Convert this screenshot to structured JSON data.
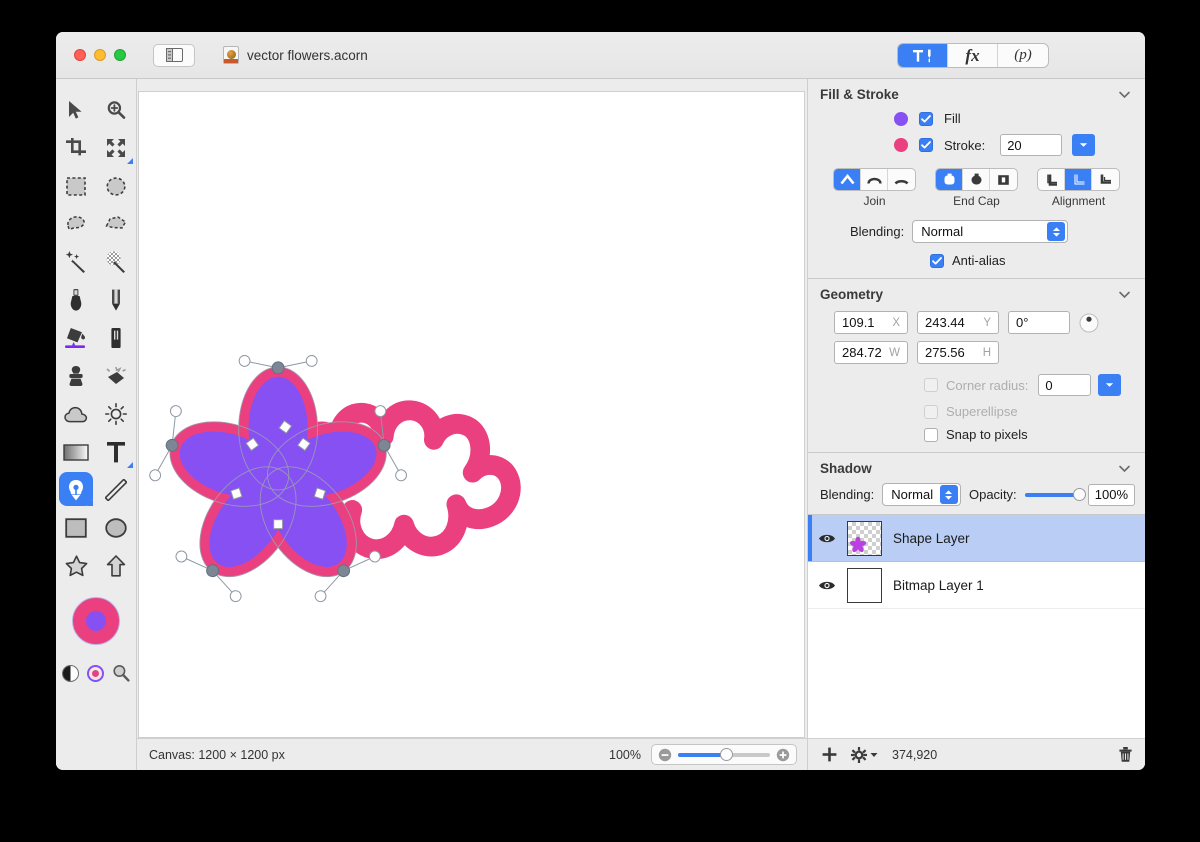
{
  "window": {
    "document_title": "vector flowers.acorn",
    "traffic_lights": [
      "close",
      "minimize",
      "zoom"
    ],
    "mode_buttons": [
      {
        "id": "tools",
        "label": "",
        "icon": "hammer-pen-icon",
        "active": true
      },
      {
        "id": "filters",
        "label": "fx",
        "icon": "fx-icon",
        "active": false
      },
      {
        "id": "palette",
        "label": "(p)",
        "icon": "palette-icon",
        "active": false
      }
    ]
  },
  "toolbar": {
    "tools": [
      {
        "name": "move-tool",
        "selected": false,
        "badge": false
      },
      {
        "name": "zoom-tool",
        "selected": false,
        "badge": false
      },
      {
        "name": "crop-tool",
        "selected": false,
        "badge": false
      },
      {
        "name": "transform-tool",
        "selected": false,
        "badge": true
      },
      {
        "name": "rect-select-tool",
        "selected": false,
        "badge": false
      },
      {
        "name": "ellipse-select-tool",
        "selected": false,
        "badge": false
      },
      {
        "name": "lasso-tool",
        "selected": false,
        "badge": false
      },
      {
        "name": "polygon-lasso-tool",
        "selected": false,
        "badge": false
      },
      {
        "name": "magic-wand-tool",
        "selected": false,
        "badge": false
      },
      {
        "name": "instant-alpha-tool",
        "selected": false,
        "badge": false
      },
      {
        "name": "brush-tool",
        "selected": false,
        "badge": false
      },
      {
        "name": "pencil-tool",
        "selected": false,
        "badge": false
      },
      {
        "name": "paint-bucket-tool",
        "selected": false,
        "badge": false
      },
      {
        "name": "eraser-tool",
        "selected": false,
        "badge": false
      },
      {
        "name": "clone-stamp-tool",
        "selected": false,
        "badge": false
      },
      {
        "name": "smudge-tool",
        "selected": false,
        "badge": false
      },
      {
        "name": "blur-tool",
        "selected": false,
        "badge": false
      },
      {
        "name": "dodge-tool",
        "selected": false,
        "badge": false
      },
      {
        "name": "gradient-tool",
        "selected": false,
        "badge": false
      },
      {
        "name": "text-tool",
        "selected": false,
        "badge": true
      },
      {
        "name": "pen-tool",
        "selected": true,
        "badge": true
      },
      {
        "name": "line-tool",
        "selected": false,
        "badge": false
      },
      {
        "name": "rectangle-tool",
        "selected": false,
        "badge": false
      },
      {
        "name": "ellipse-tool",
        "selected": false,
        "badge": false
      },
      {
        "name": "star-tool",
        "selected": false,
        "badge": false
      },
      {
        "name": "arrow-tool",
        "selected": false,
        "badge": false
      }
    ],
    "swatch_outer_color": "#ea4080",
    "swatch_inner_color": "#8750f2",
    "mini_controls": [
      "black-white-swatch-icon",
      "swap-swatch-icon",
      "loupe-icon"
    ]
  },
  "canvas": {
    "background": "#ffffff",
    "shape": {
      "name": "five-petal-flower",
      "fill_color": "#8750f2",
      "stroke_color": "#ea4080",
      "stroke_width": 20,
      "petals": 5
    }
  },
  "status_bar": {
    "canvas_label": "Canvas: 1200 × 1200 px",
    "zoom_level": "100%",
    "add_label": "+",
    "gear_label": "",
    "memory_label": "374,920",
    "trash_label": ""
  },
  "inspector": {
    "fill_stroke": {
      "title": "Fill & Stroke",
      "fill": {
        "label": "Fill",
        "checked": true,
        "color": "#8750f2"
      },
      "stroke": {
        "label": "Stroke:",
        "checked": true,
        "color": "#ea4080",
        "width": "20"
      },
      "join": {
        "caption": "Join",
        "options": [
          "miter-join-icon",
          "round-join-icon",
          "bevel-join-icon"
        ],
        "selected_index": 0
      },
      "end_cap": {
        "caption": "End Cap",
        "options": [
          "butt-cap-icon",
          "round-cap-icon",
          "square-cap-icon"
        ],
        "selected_index": 0
      },
      "alignment": {
        "caption": "Alignment",
        "options": [
          "align-inside-icon",
          "align-center-icon",
          "align-outside-icon"
        ],
        "selected_index": 1
      },
      "blending": {
        "label": "Blending:",
        "value": "Normal"
      },
      "anti_alias": {
        "label": "Anti-alias",
        "checked": true
      }
    },
    "geometry": {
      "title": "Geometry",
      "x": {
        "value": "109.1",
        "unit": "X"
      },
      "y": {
        "value": "243.44",
        "unit": "Y"
      },
      "rotation": {
        "value": "0°"
      },
      "w": {
        "value": "284.72",
        "unit": "W"
      },
      "h": {
        "value": "275.56",
        "unit": "H"
      },
      "corner_radius": {
        "label": "Corner radius:",
        "value": "0",
        "checked": false,
        "enabled": false
      },
      "superellipse": {
        "label": "Superellipse",
        "checked": false,
        "enabled": false
      },
      "snap_to_pixels": {
        "label": "Snap to pixels",
        "checked": false,
        "enabled": true
      }
    },
    "shadow": {
      "title": "Shadow",
      "blending": {
        "label": "Blending:",
        "value": "Normal"
      },
      "opacity": {
        "label": "Opacity:",
        "value": "100%"
      }
    },
    "layers": [
      {
        "name": "Shape Layer",
        "visible": true,
        "selected": true,
        "thumb": "shape"
      },
      {
        "name": "Bitmap Layer 1",
        "visible": true,
        "selected": false,
        "thumb": "white"
      }
    ]
  },
  "colors": {
    "accent": "#3b7ff5",
    "fill_purple": "#8750f2",
    "stroke_pink": "#ea4080",
    "window_chrome": "#ececec"
  }
}
